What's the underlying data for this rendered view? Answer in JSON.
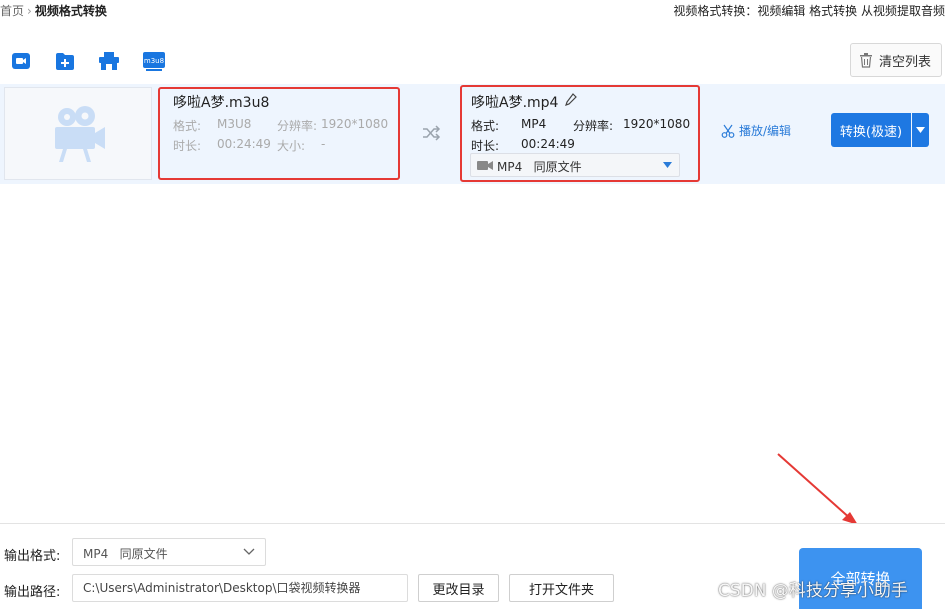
{
  "breadcrumb": {
    "home": "首页",
    "current": "视频格式转换"
  },
  "topnav": {
    "text": "视频格式转换：视频编辑 格式转换 从视频提取音频"
  },
  "toolbar": {
    "tools": [
      {
        "name": "add-video-icon"
      },
      {
        "name": "add-folder-icon"
      },
      {
        "name": "dvd-icon"
      },
      {
        "name": "m3u8-icon",
        "label": "m3u8"
      }
    ],
    "clear_label": "清空列表"
  },
  "file": {
    "source": {
      "name": "哆啦A梦.m3u8",
      "format_label": "格式:",
      "format": "M3U8",
      "resolution_label": "分辨率:",
      "resolution": "1920*1080",
      "duration_label": "时长:",
      "duration": "00:24:49",
      "size_label": "大小:",
      "size": "-"
    },
    "target": {
      "name": "哆啦A梦.mp4",
      "format_label": "格式:",
      "format": "MP4",
      "resolution_label": "分辨率:",
      "resolution": "1920*1080",
      "duration_label": "时长:",
      "duration": "00:24:49",
      "select_value": "MP4   同原文件"
    },
    "play_edit_label": "播放/编辑",
    "convert_label": "转换(极速)"
  },
  "bottom": {
    "output_format_label": "输出格式:",
    "output_format_value": "MP4   同原文件",
    "output_path_label": "输出路径:",
    "output_path_value": "C:\\Users\\Administrator\\Desktop\\口袋视频转换器",
    "change_dir_label": "更改目录",
    "open_folder_label": "打开文件夹",
    "convert_all_label": "全部转换"
  },
  "watermark": "CSDN @科技分享小助手",
  "colors": {
    "accent": "#1e78e2",
    "highlight_box": "#e53935",
    "row_bg": "#eef5fe"
  }
}
